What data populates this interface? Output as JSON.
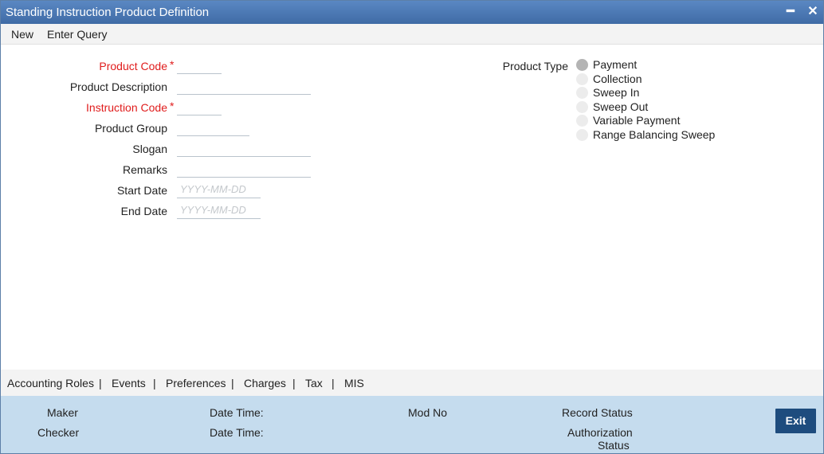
{
  "window": {
    "title": "Standing Instruction Product Definition",
    "minimize_symbol": "━",
    "close_symbol": "✕"
  },
  "menu": {
    "new": "New",
    "enter_query": "Enter Query"
  },
  "form": {
    "product_code": {
      "label": "Product Code",
      "value": ""
    },
    "product_description": {
      "label": "Product Description",
      "value": ""
    },
    "instruction_code": {
      "label": "Instruction Code",
      "value": ""
    },
    "product_group": {
      "label": "Product Group",
      "value": ""
    },
    "slogan": {
      "label": "Slogan",
      "value": ""
    },
    "remarks": {
      "label": "Remarks",
      "value": ""
    },
    "start_date": {
      "label": "Start Date",
      "value": "",
      "placeholder": "YYYY-MM-DD"
    },
    "end_date": {
      "label": "End Date",
      "value": "",
      "placeholder": "YYYY-MM-DD"
    },
    "required_marker": "*"
  },
  "product_type": {
    "label": "Product Type",
    "options": [
      "Payment",
      "Collection",
      "Sweep In",
      "Sweep Out",
      "Variable Payment",
      "Range Balancing Sweep"
    ],
    "selected": "Payment"
  },
  "tabs": {
    "items": [
      "Accounting Roles",
      "Events",
      "Preferences",
      "Charges",
      "Tax",
      "MIS"
    ],
    "separator": "|"
  },
  "footer": {
    "maker": "Maker",
    "checker": "Checker",
    "date_time_1": "Date Time:",
    "date_time_2": "Date Time:",
    "mod_no": "Mod No",
    "record_status": "Record Status",
    "authorization_line1": "Authorization",
    "authorization_line2": "Status",
    "exit": "Exit"
  },
  "colors": {
    "titlebar": "#4a7bb7",
    "required_label": "#e01c1c",
    "footer_bg": "#c5dcee",
    "exit_button": "#1e4c7e"
  }
}
